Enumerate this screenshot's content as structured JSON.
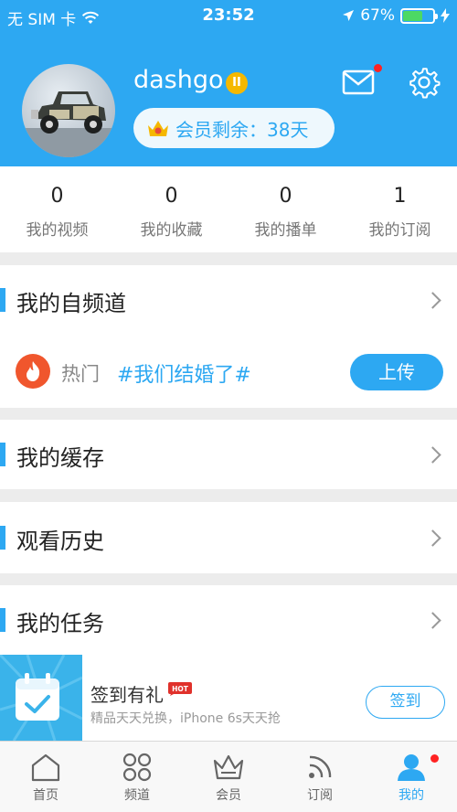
{
  "status_bar": {
    "carrier": "无 SIM 卡",
    "time": "23:52",
    "battery_percent": "67%",
    "battery_level": 0.67
  },
  "profile": {
    "username": "dashgo",
    "vip_remaining": "会员剩余：38天"
  },
  "stats": [
    {
      "count": "0",
      "label": "我的视频"
    },
    {
      "count": "0",
      "label": "我的收藏"
    },
    {
      "count": "0",
      "label": "我的播单"
    },
    {
      "count": "1",
      "label": "我的订阅"
    }
  ],
  "sections": {
    "channel": "我的自频道",
    "cache": "我的缓存",
    "history": "观看历史",
    "tasks": "我的任务"
  },
  "hot": {
    "label": "热门",
    "topic": "#我们结婚了#",
    "upload_label": "上传"
  },
  "signin": {
    "title": "签到有礼",
    "tag": "HOT",
    "subtitle": "精品天天兑换，iPhone 6s天天抢",
    "button": "签到"
  },
  "tabs": [
    {
      "label": "首页"
    },
    {
      "label": "频道"
    },
    {
      "label": "会员"
    },
    {
      "label": "订阅"
    },
    {
      "label": "我的"
    }
  ],
  "colors": {
    "accent": "#2da8f2",
    "alert_dot": "#ff2222",
    "fire": "#f0562d",
    "vip_gold": "#f5b800"
  }
}
